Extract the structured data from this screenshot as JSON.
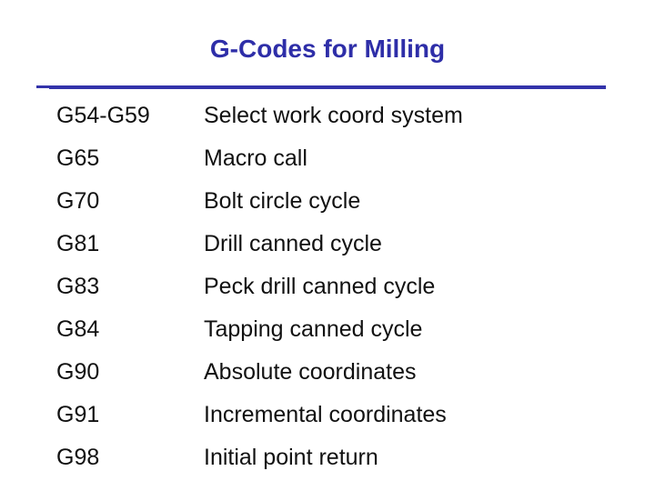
{
  "title": "G-Codes for Milling",
  "colors": {
    "title": "#2e2ea8",
    "rule": "#3333aa",
    "text": "#111111",
    "background": "#ffffff"
  },
  "rows": [
    {
      "code": "G54-G59",
      "description": "Select work coord system"
    },
    {
      "code": "G65",
      "description": "Macro call"
    },
    {
      "code": "G70",
      "description": "Bolt circle cycle"
    },
    {
      "code": "G81",
      "description": "Drill canned cycle"
    },
    {
      "code": "G83",
      "description": "Peck drill canned cycle"
    },
    {
      "code": "G84",
      "description": "Tapping canned cycle"
    },
    {
      "code": "G90",
      "description": "Absolute coordinates"
    },
    {
      "code": "G91",
      "description": "Incremental coordinates"
    },
    {
      "code": "G98",
      "description": "Initial point return"
    }
  ]
}
